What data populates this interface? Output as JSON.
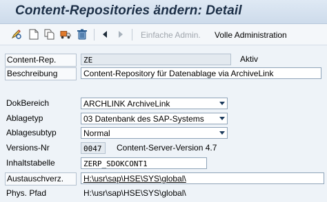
{
  "window": {
    "title": "Content-Repositories ändern: Detail"
  },
  "toolbar": {
    "icons": [
      "display-change-icon",
      "create-icon",
      "copy-icon",
      "transport-icon",
      "delete-icon",
      "previous-icon",
      "next-icon"
    ],
    "simple_admin_label": "Einfache Admin.",
    "full_admin_label": "Volle Administration"
  },
  "form": {
    "content_rep": {
      "label": "Content-Rep.",
      "value": "ZE",
      "status": "Aktiv"
    },
    "description": {
      "label": "Beschreibung",
      "value": "Content-Repository für Datenablage via ArchiveLink"
    },
    "doc_area": {
      "label": "DokBereich",
      "value": "ARCHLINK ArchiveLink"
    },
    "storage_type": {
      "label": "Ablagetyp",
      "value": "03 Datenbank des SAP-Systems"
    },
    "storage_subtype": {
      "label": "Ablagesubtyp",
      "value": "Normal"
    },
    "version": {
      "label": "Versions-Nr",
      "value": "0047",
      "server_version": "Content-Server-Version 4.7"
    },
    "content_table": {
      "label": "Inhaltstabelle",
      "value": "ZERP_SDOKCONT1"
    },
    "exchange_dir": {
      "label": "Austauschverz.",
      "value": "H:\\usr\\sap\\HSE\\SYS\\global\\"
    },
    "phys_path": {
      "label": "Phys. Pfad",
      "value": "H:\\usr\\sap\\HSE\\SYS\\global\\"
    }
  }
}
